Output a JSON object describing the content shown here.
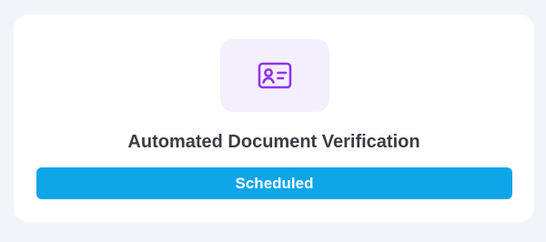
{
  "card": {
    "icon": "id-card-icon",
    "title": "Automated Document Verification",
    "status_label": "Scheduled"
  },
  "colors": {
    "page_background": "#f1f4f8",
    "card_background": "#ffffff",
    "icon_tile_background": "#f3effd",
    "icon_color": "#9333ea",
    "title_color": "#3a3d45",
    "status_background": "#0ea5e9",
    "status_text": "#ffffff"
  }
}
